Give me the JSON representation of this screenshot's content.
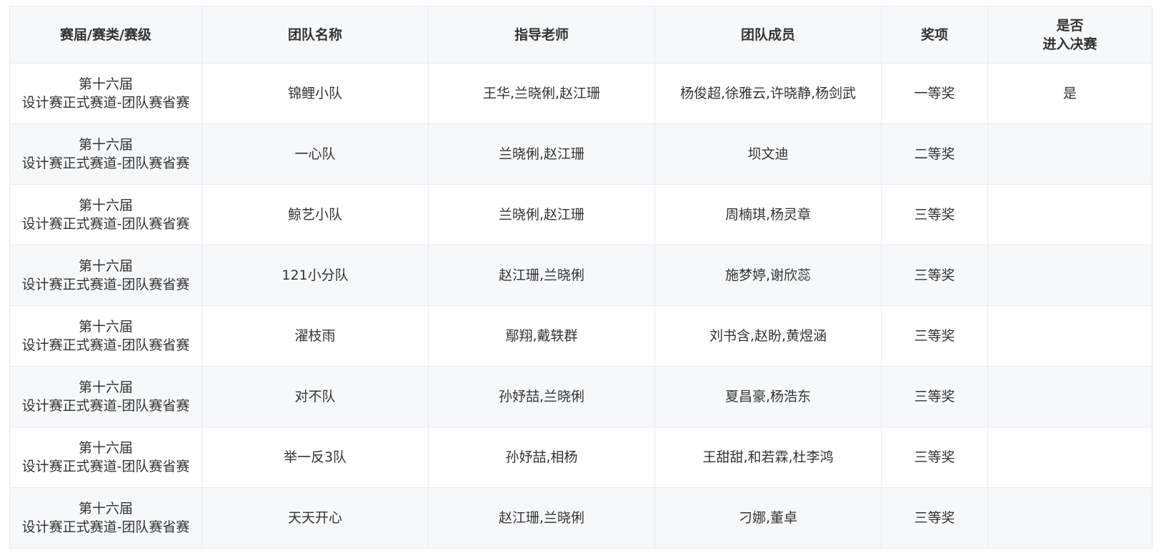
{
  "table": {
    "headers": {
      "session": "赛届/赛类/赛级",
      "team_name": "团队名称",
      "advisor": "指导老师",
      "members": "团队成员",
      "award": "奖项",
      "final_line1": "是否",
      "final_line2": "进入决赛"
    },
    "rows": [
      {
        "session_line1": "第十六届",
        "session_line2": "设计赛正式赛道-团队赛省赛",
        "team_name": "锦鲤小队",
        "advisor": "王华,兰晓俐,赵江珊",
        "members": "杨俊超,徐雅云,许晓静,杨剑武",
        "award": "一等奖",
        "final": "是"
      },
      {
        "session_line1": "第十六届",
        "session_line2": "设计赛正式赛道-团队赛省赛",
        "team_name": "一心队",
        "advisor": "兰晓俐,赵江珊",
        "members": "坝文迪",
        "award": "二等奖",
        "final": ""
      },
      {
        "session_line1": "第十六届",
        "session_line2": "设计赛正式赛道-团队赛省赛",
        "team_name": "鲸艺小队",
        "advisor": "兰晓俐,赵江珊",
        "members": "周楠琪,杨灵章",
        "award": "三等奖",
        "final": ""
      },
      {
        "session_line1": "第十六届",
        "session_line2": "设计赛正式赛道-团队赛省赛",
        "team_name": "121小分队",
        "advisor": "赵江珊,兰晓俐",
        "members": "施梦婷,谢欣蕊",
        "award": "三等奖",
        "final": ""
      },
      {
        "session_line1": "第十六届",
        "session_line2": "设计赛正式赛道-团队赛省赛",
        "team_name": "濯枝雨",
        "advisor": "鄢翔,戴轶群",
        "members": "刘书含,赵盼,黄煜涵",
        "award": "三等奖",
        "final": ""
      },
      {
        "session_line1": "第十六届",
        "session_line2": "设计赛正式赛道-团队赛省赛",
        "team_name": "对不队",
        "advisor": "孙妤喆,兰晓俐",
        "members": "夏昌豪,杨浩东",
        "award": "三等奖",
        "final": ""
      },
      {
        "session_line1": "第十六届",
        "session_line2": "设计赛正式赛道-团队赛省赛",
        "team_name": "举一反3队",
        "advisor": "孙妤喆,相杨",
        "members": "王甜甜,和若霖,杜李鸿",
        "award": "三等奖",
        "final": ""
      },
      {
        "session_line1": "第十六届",
        "session_line2": "设计赛正式赛道-团队赛省赛",
        "team_name": "天天开心",
        "advisor": "赵江珊,兰晓俐",
        "members": "刁娜,董卓",
        "award": "三等奖",
        "final": ""
      }
    ]
  }
}
